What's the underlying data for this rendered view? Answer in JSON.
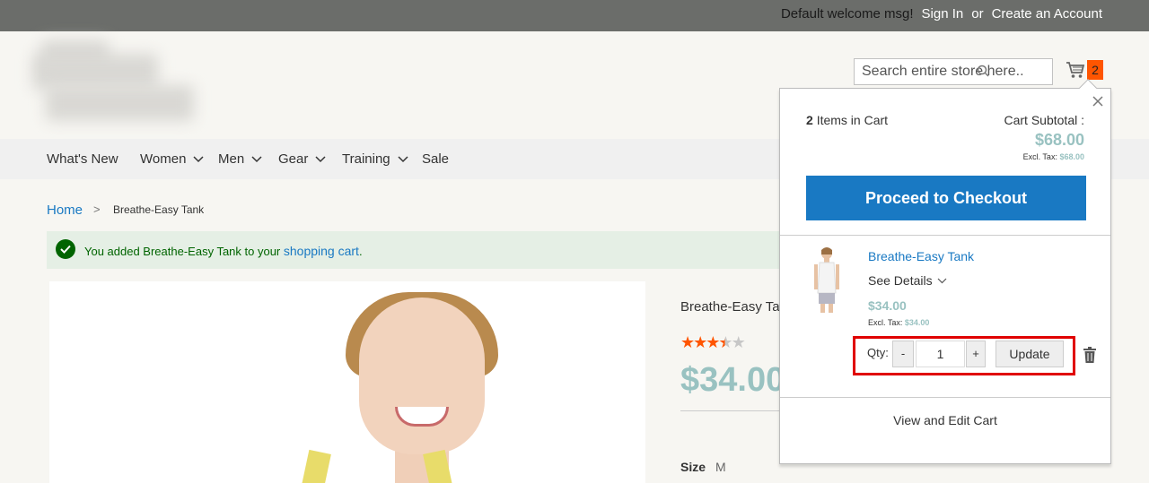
{
  "topbar": {
    "welcome": "Default welcome msg!",
    "sign_in": "Sign In",
    "or": "or",
    "create_account": "Create an Account"
  },
  "search": {
    "placeholder": "Search entire store here.."
  },
  "cart": {
    "count": "2"
  },
  "nav": {
    "items": [
      {
        "label": "What's New",
        "has_dropdown": false
      },
      {
        "label": "Women",
        "has_dropdown": true
      },
      {
        "label": "Men",
        "has_dropdown": true
      },
      {
        "label": "Gear",
        "has_dropdown": true
      },
      {
        "label": "Training",
        "has_dropdown": true
      },
      {
        "label": "Sale",
        "has_dropdown": false
      }
    ]
  },
  "breadcrumb": {
    "home": "Home",
    "separator": ">",
    "current": "Breathe-Easy Tank"
  },
  "message": {
    "text": "You added Breathe-Easy Tank to your",
    "link": "shopping cart",
    "suffix": "."
  },
  "product": {
    "name": "Breathe-Easy Tank",
    "rating_stars": 3.5,
    "rating_max": 5,
    "price": "$34.00",
    "size_label": "Size",
    "size_value": "M"
  },
  "minicart": {
    "items_count": "2",
    "items_label": "Items in Cart",
    "subtotal_label": "Cart Subtotal :",
    "subtotal_value": "$68.00",
    "excl_tax_label": "Excl. Tax:",
    "excl_tax_value": "$68.00",
    "checkout_label": "Proceed to Checkout",
    "item": {
      "name": "Breathe-Easy Tank",
      "see_details": "See Details",
      "price": "$34.00",
      "excl_tax_label": "Excl. Tax:",
      "excl_tax_value": "$34.00",
      "qty_label": "Qty:",
      "qty_minus": "-",
      "qty_value": "1",
      "qty_plus": "+",
      "update_label": "Update"
    },
    "view_cart": "View and Edit Cart"
  },
  "colors": {
    "accent_blue": "#1979c3",
    "price_teal": "#99c2c1",
    "cart_badge": "#ff5501",
    "highlight_box": "#e00000",
    "success_green": "#006400"
  }
}
